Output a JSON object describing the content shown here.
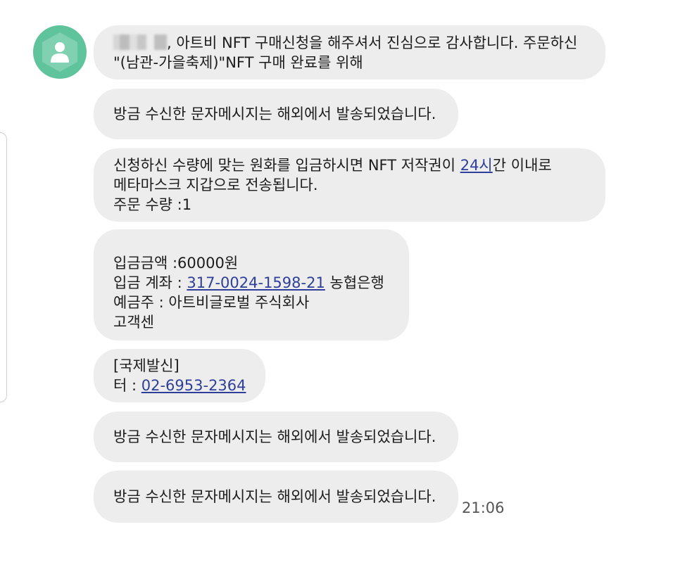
{
  "sender": {
    "avatar_icon": "person-icon",
    "avatar_color": "#5fc39c"
  },
  "messages": [
    {
      "lines": [
        ", 아트비 NFT 구매신청을 해주셔서 진심으로 감사합니다. 주문하신",
        "\"(남관-가을축제)\"NFT 구매 완료를 위해"
      ]
    },
    {
      "lines": [
        "방금 수신한 문자메시지는 해외에서 발송되었습니다."
      ]
    },
    {
      "line1_before": "신청하신 수량에 맞는 원화를 입금하시면 NFT  저작권이 ",
      "line1_link": "24시",
      "line1_after": "간 이내로",
      "line2": "메타마스크 지갑으로 전송됩니다.",
      "line3": "주문 수량 :1"
    },
    {
      "amount": "입금금액 :60000원",
      "account_prefix": "입금 계좌 : ",
      "account_number": "317-0024-1598-21",
      "account_bank": " 농협은행",
      "holder": "예금주 : 아트비글로벌 주식회사",
      "support": "고객센"
    },
    {
      "line1": "[국제발신]",
      "phone_prefix": "터 : ",
      "phone_number": "02-6953-2364"
    },
    {
      "lines": [
        "방금 수신한 문자메시지는 해외에서 발송되었습니다."
      ]
    },
    {
      "lines": [
        "방금 수신한 문자메시지는 해외에서 발송되었습니다."
      ]
    }
  ],
  "timestamp": "21:06",
  "colors": {
    "bubble": "#ededed",
    "link": "#2e3f9a",
    "text": "#1c1c1c"
  }
}
